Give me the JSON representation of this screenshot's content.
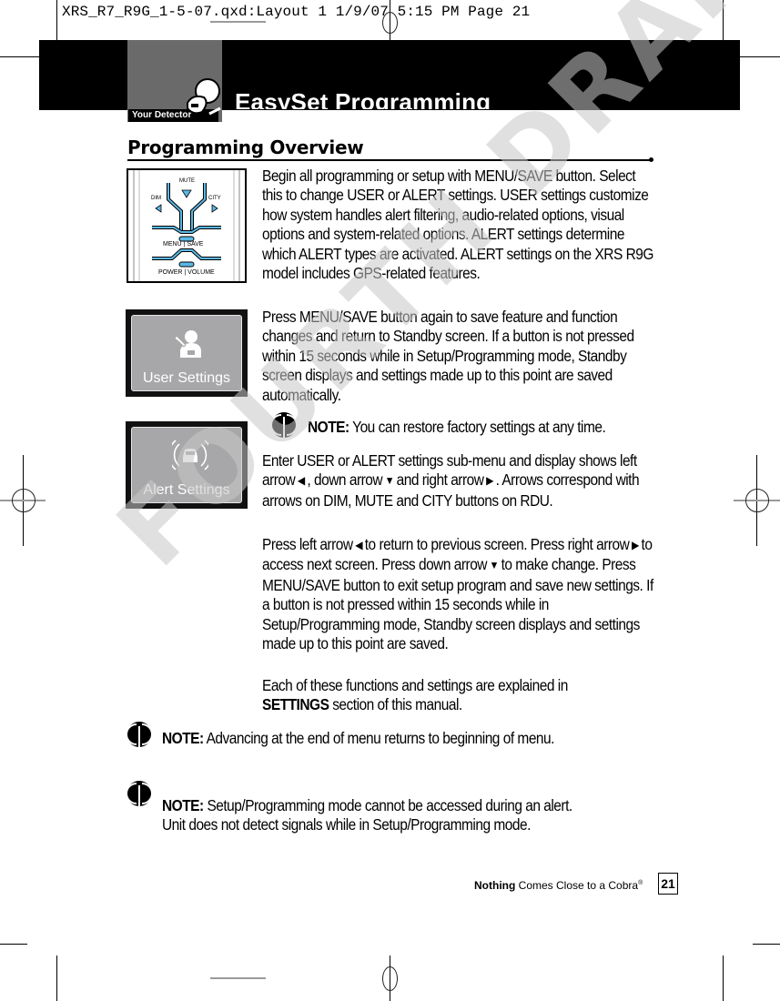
{
  "slug": "XRS_R7_R9G_1-5-07.qxd:Layout 1  1/9/07  5:15 PM  Page 21",
  "header": {
    "tab_label": "Your Detector",
    "title": "EasySet Programming",
    "icon": "detector-icon"
  },
  "section": {
    "title": "Programming Overview"
  },
  "images": {
    "rdu": {
      "icon": "rdu-buttons-illustration",
      "labels": {
        "mute": "MUTE",
        "dim": "DIM",
        "city": "CITY",
        "menu_save": "MENU | SAVE",
        "power_volume": "POWER | VOLUME"
      },
      "accent": "#5bb8e6"
    },
    "user_settings": {
      "label": "User Settings",
      "icon": "user-wrench-icon"
    },
    "alert_settings": {
      "label": "Alert Settings",
      "icon": "car-alert-icon"
    }
  },
  "paragraphs": [
    "Begin all programming or setup with MENU/SAVE button. Select this to change USER or ALERT settings. USER settings customize how system handles alert filtering, audio-related options, visual options and system-related options. ALERT settings determine which ALERT types are activated. ALERT settings on the XRS R9G model includes GPS-related features.",
    "Press MENU/SAVE button again to save feature and function changes and return to Standby screen. If a button is not pressed within 15 seconds while in Setup/Programming mode, Standby screen displays and settings made up to this point are saved automatically."
  ],
  "note1": {
    "label": "NOTE:",
    "text": " You can restore factory settings at any time."
  },
  "para3": {
    "a": "Enter USER or ALERT settings sub-menu and display shows left arrow",
    "b": ", down arrow",
    "c": "and right arrow",
    "d": ". Arrows correspond with arrows on DIM, MUTE and CITY buttons on RDU."
  },
  "para4": {
    "a": "Press left arrow",
    "b": "to return to previous screen. Press right arrow",
    "c": "to access next screen. Press down arrow",
    "d": "to make change. Press MENU/SAVE button to exit setup program and save new settings. If a button is not pressed within 15 seconds while in Setup/Programming mode, Standby screen displays and settings made up to this point are saved."
  },
  "para5": {
    "a": "Each of these functions and settings are explained in",
    "bold": "SETTINGS",
    "b": " section of this manual."
  },
  "note2": {
    "label": "NOTE:",
    "text": " Advancing at the end of menu returns to beginning of menu."
  },
  "note3": {
    "label": "NOTE:",
    "line1": " Setup/Programming mode cannot be accessed during an alert.",
    "line2": "Unit does not detect signals while in Setup/Programming mode."
  },
  "arrows": {
    "left": "◀",
    "down": "▼",
    "right": "▶"
  },
  "footer": {
    "bold": "Nothing",
    "text": " Comes Close to a Cobra",
    "reg": "®",
    "page_number": "21"
  },
  "watermark": "FOURTH DRAFT"
}
